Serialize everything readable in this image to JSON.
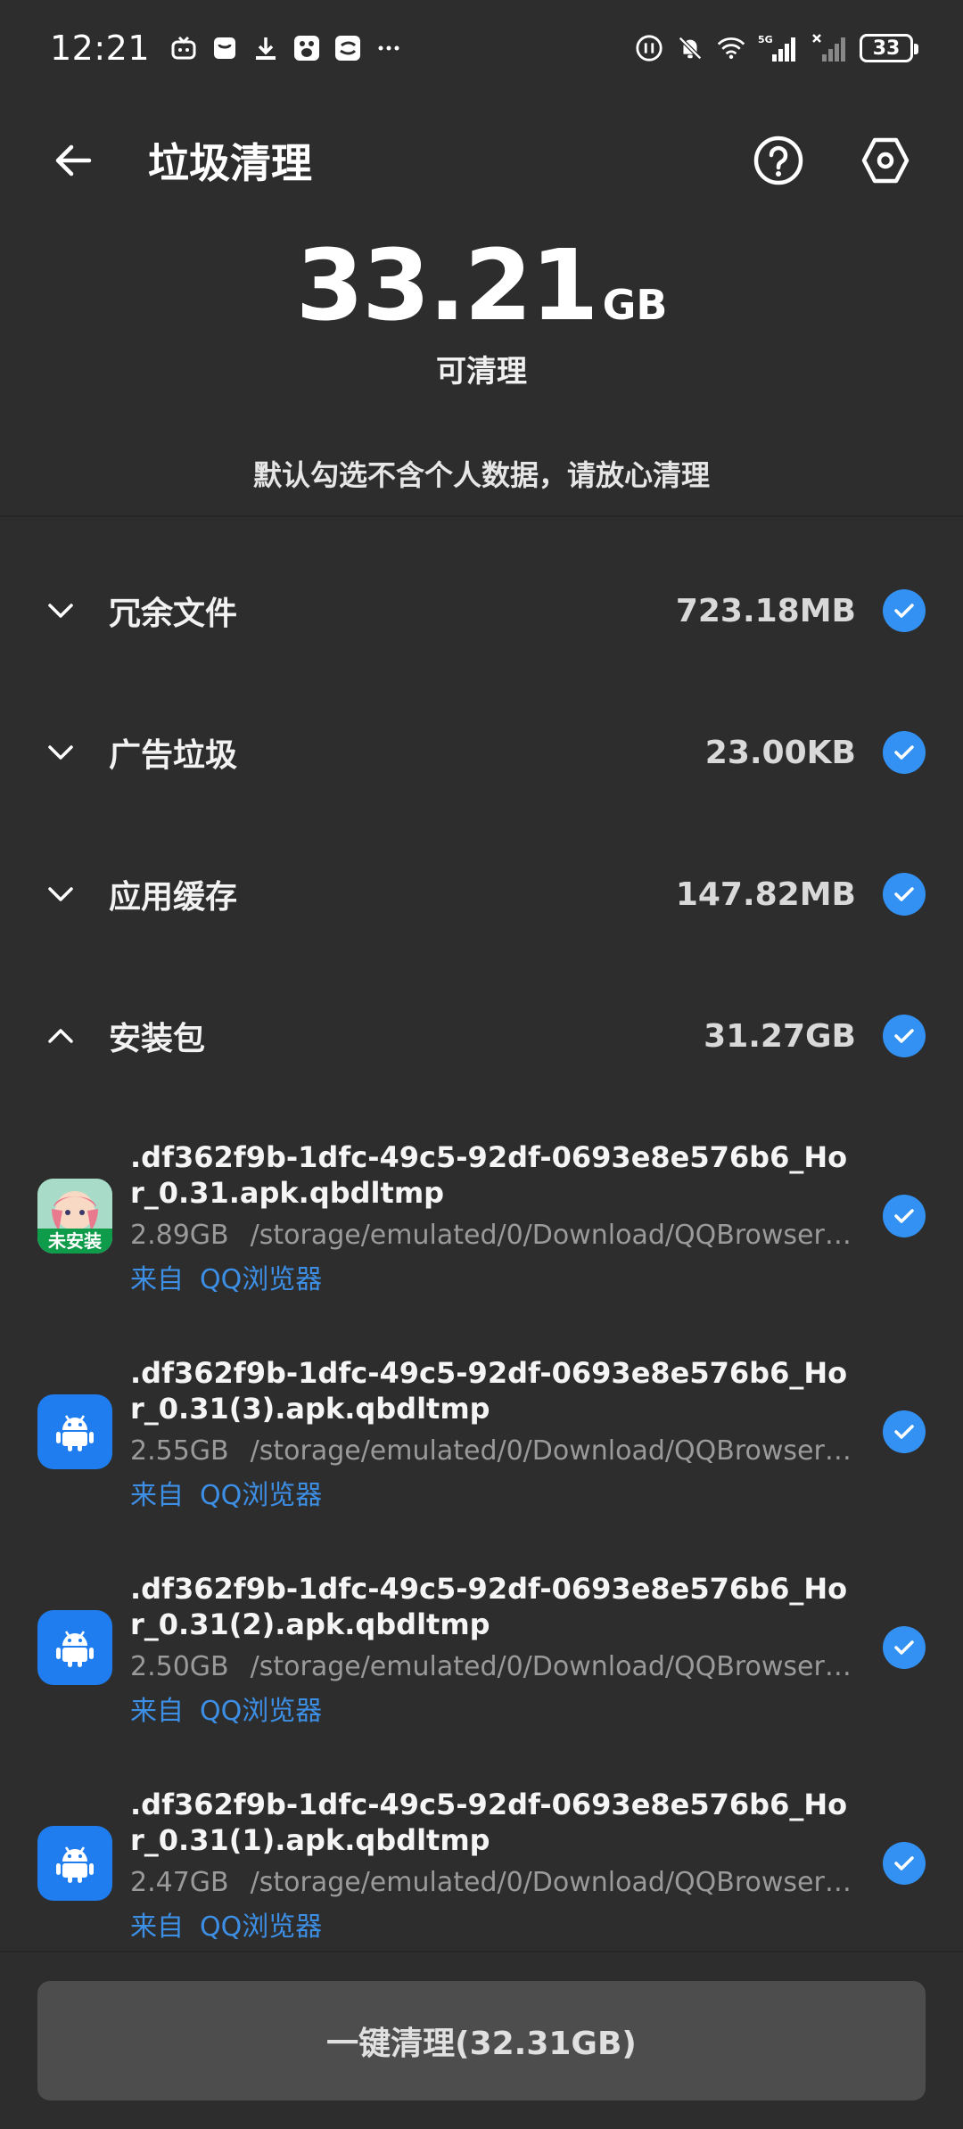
{
  "status_bar": {
    "time": "12:21",
    "network_label": "5G",
    "battery": "33"
  },
  "header": {
    "title": "垃圾清理"
  },
  "summary": {
    "size": "33.21",
    "unit": "GB",
    "subtitle": "可清理",
    "notice": "默认勾选不含个人数据，请放心清理"
  },
  "categories": [
    {
      "label": "冗余文件",
      "size": "723.18MB",
      "checked": true,
      "expanded": false
    },
    {
      "label": "广告垃圾",
      "size": "23.00KB",
      "checked": true,
      "expanded": false
    },
    {
      "label": "应用缓存",
      "size": "147.82MB",
      "checked": true,
      "expanded": false
    },
    {
      "label": "安装包",
      "size": "31.27GB",
      "checked": true,
      "expanded": true
    }
  ],
  "files": [
    {
      "name": ".df362f9b-1dfc-49c5-92df-0693e8e576b6_Hor_0.31.apk.qbdltmp",
      "size": "2.89GB",
      "path": "/storage/emulated/0/Download/QQBrowser/...",
      "source_prefix": "来自",
      "source": "QQ浏览器",
      "icon": "anime-app-icon",
      "badge": "未安装"
    },
    {
      "name": ".df362f9b-1dfc-49c5-92df-0693e8e576b6_Hor_0.31(3).apk.qbdltmp",
      "size": "2.55GB",
      "path": "/storage/emulated/0/Download/QQBrowser/...",
      "source_prefix": "来自",
      "source": "QQ浏览器",
      "icon": "android-icon"
    },
    {
      "name": ".df362f9b-1dfc-49c5-92df-0693e8e576b6_Hor_0.31(2).apk.qbdltmp",
      "size": "2.50GB",
      "path": "/storage/emulated/0/Download/QQBrowser/...",
      "source_prefix": "来自",
      "source": "QQ浏览器",
      "icon": "android-icon"
    },
    {
      "name": ".df362f9b-1dfc-49c5-92df-0693e8e576b6_Hor_0.31(1).apk.qbdltmp",
      "size": "2.47GB",
      "path": "/storage/emulated/0/Download/QQBrowser/...",
      "source_prefix": "来自",
      "source": "QQ浏览器",
      "icon": "android-icon"
    }
  ],
  "bottom": {
    "clean_button": "一键清理(32.31GB)"
  },
  "colors": {
    "background": "#2d2d2d",
    "accent": "#3391f3",
    "source_link": "#3d8fe6",
    "button_bg": "#4d4d4d"
  }
}
